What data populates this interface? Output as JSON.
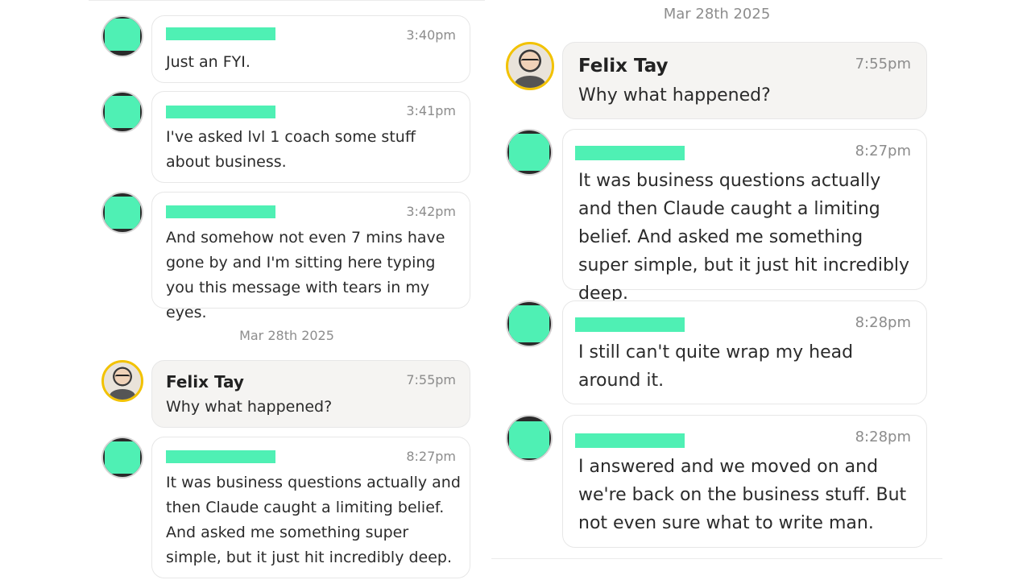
{
  "left_panel": {
    "messages": [
      {
        "time": "3:40pm",
        "text": "Just an FYI."
      },
      {
        "time": "3:41pm",
        "text": "I've asked lvl 1 coach some stuff about business."
      },
      {
        "time": "3:42pm",
        "text": "And somehow not even 7 mins have gone by and I'm sitting here typing you this message with tears in my eyes."
      }
    ],
    "date_separator": "Mar 28th 2025",
    "reply": {
      "sender": "Felix Tay",
      "time": "7:55pm",
      "text": "Why what happened?"
    },
    "last": {
      "time": "8:27pm",
      "text": "It was business questions actually and then Claude caught a limiting belief. And asked me something super simple, but it just hit incredibly deep."
    }
  },
  "right_panel": {
    "date_separator": "Mar 28th 2025",
    "reply": {
      "sender": "Felix Tay",
      "time": "7:55pm",
      "text": "Why what happened?"
    },
    "messages": [
      {
        "time": "8:27pm",
        "text": "It was business questions actually and then Claude caught a limiting belief. And asked me something super simple, but it just hit incredibly deep."
      },
      {
        "time": "8:28pm",
        "text": "I still can't quite wrap my head around it."
      },
      {
        "time": "8:28pm",
        "text": "I answered and we moved on and we're back on the business stuff. But not even sure what to write man."
      }
    ]
  },
  "colors": {
    "redaction": "#4ff0b4",
    "avatar_ring": "#f2c200",
    "shaded_bubble": "#f5f4f2"
  }
}
